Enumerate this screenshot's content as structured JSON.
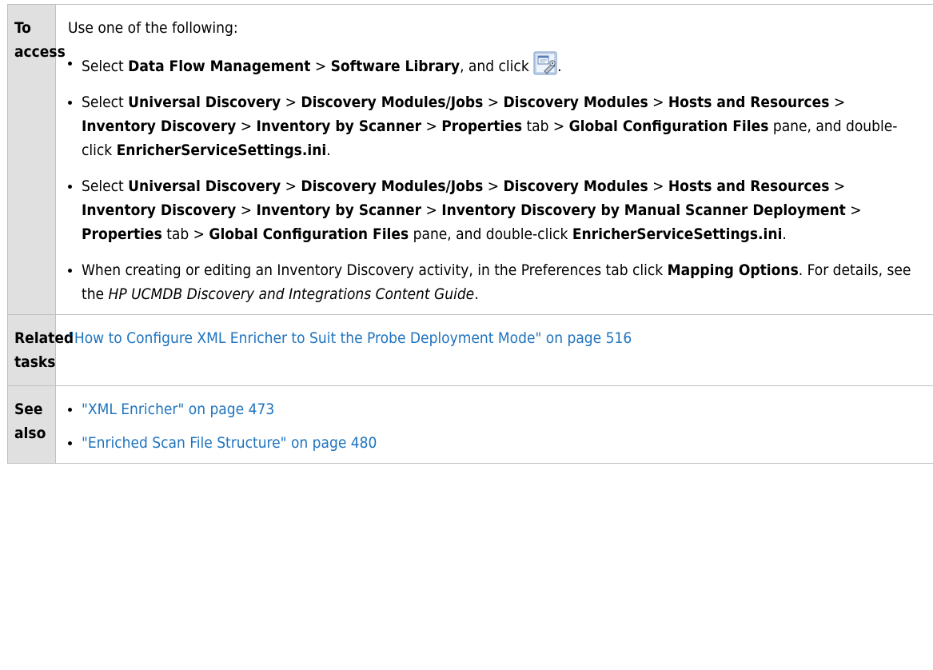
{
  "rows": {
    "access": {
      "header": "To access",
      "intro": "Use one of the following:",
      "items": [
        [
          {
            "t": "Select "
          },
          {
            "t": "Data Flow Management",
            "b": true
          },
          {
            "t": " > "
          },
          {
            "t": "Software Library",
            "b": true
          },
          {
            "t": ", and click "
          },
          {
            "icon": "software-library-tool-icon"
          },
          {
            "t": "."
          }
        ],
        [
          {
            "t": "Select "
          },
          {
            "t": "Universal Discovery",
            "b": true
          },
          {
            "t": " > "
          },
          {
            "t": "Discovery Modules/Jobs",
            "b": true
          },
          {
            "t": " > "
          },
          {
            "t": "Discovery Modules",
            "b": true
          },
          {
            "t": "  > "
          },
          {
            "t": "Hosts and Resources",
            "b": true
          },
          {
            "t": " > "
          },
          {
            "t": "Inventory Discovery",
            "b": true
          },
          {
            "t": " > "
          },
          {
            "t": "Inventory by Scanner",
            "b": true
          },
          {
            "t": " > "
          },
          {
            "t": "Properties",
            "b": true
          },
          {
            "t": " tab > "
          },
          {
            "t": "Global Configuration Files",
            "b": true
          },
          {
            "t": " pane, and double-click "
          },
          {
            "t": "EnricherServiceSettings.ini",
            "b": true
          },
          {
            "t": "."
          }
        ],
        [
          {
            "t": "Select "
          },
          {
            "t": "Universal Discovery",
            "b": true
          },
          {
            "t": " > "
          },
          {
            "t": "Discovery Modules/Jobs",
            "b": true
          },
          {
            "t": " > "
          },
          {
            "t": "Discovery Modules",
            "b": true
          },
          {
            "t": "  > "
          },
          {
            "t": "Hosts and Resources",
            "b": true
          },
          {
            "t": " > "
          },
          {
            "t": "Inventory Discovery",
            "b": true
          },
          {
            "t": " > "
          },
          {
            "t": "Inventory by Scanner",
            "b": true
          },
          {
            "t": " > "
          },
          {
            "t": "Inventory Discovery by Manual Scanner Deployment",
            "b": true
          },
          {
            "t": " > "
          },
          {
            "t": "Properties",
            "b": true
          },
          {
            "t": " tab > "
          },
          {
            "t": "Global Configuration Files",
            "b": true
          },
          {
            "t": " pane, and double-click "
          },
          {
            "t": "EnricherServiceSettings.ini",
            "b": true
          },
          {
            "t": "."
          }
        ],
        [
          {
            "t": "When creating or editing an Inventory Discovery activity, in the Preferences tab click "
          },
          {
            "t": "Mapping Options",
            "b": true
          },
          {
            "t": ". For details, see the "
          },
          {
            "t": "HP UCMDB Discovery and Integrations Content Guide",
            "i": true
          },
          {
            "t": "."
          }
        ]
      ]
    },
    "related": {
      "header": "Related tasks",
      "link": "\"How to Configure XML Enricher to Suit the Probe Deployment Mode\" on page 516"
    },
    "see_also": {
      "header": "See also",
      "links": [
        "\"XML Enricher\" on page 473",
        "\"Enriched Scan File Structure\" on page 480"
      ]
    }
  },
  "colors": {
    "link": "#1e73be",
    "header_bg": "#e0e0e0",
    "border": "#c0c0c0"
  }
}
